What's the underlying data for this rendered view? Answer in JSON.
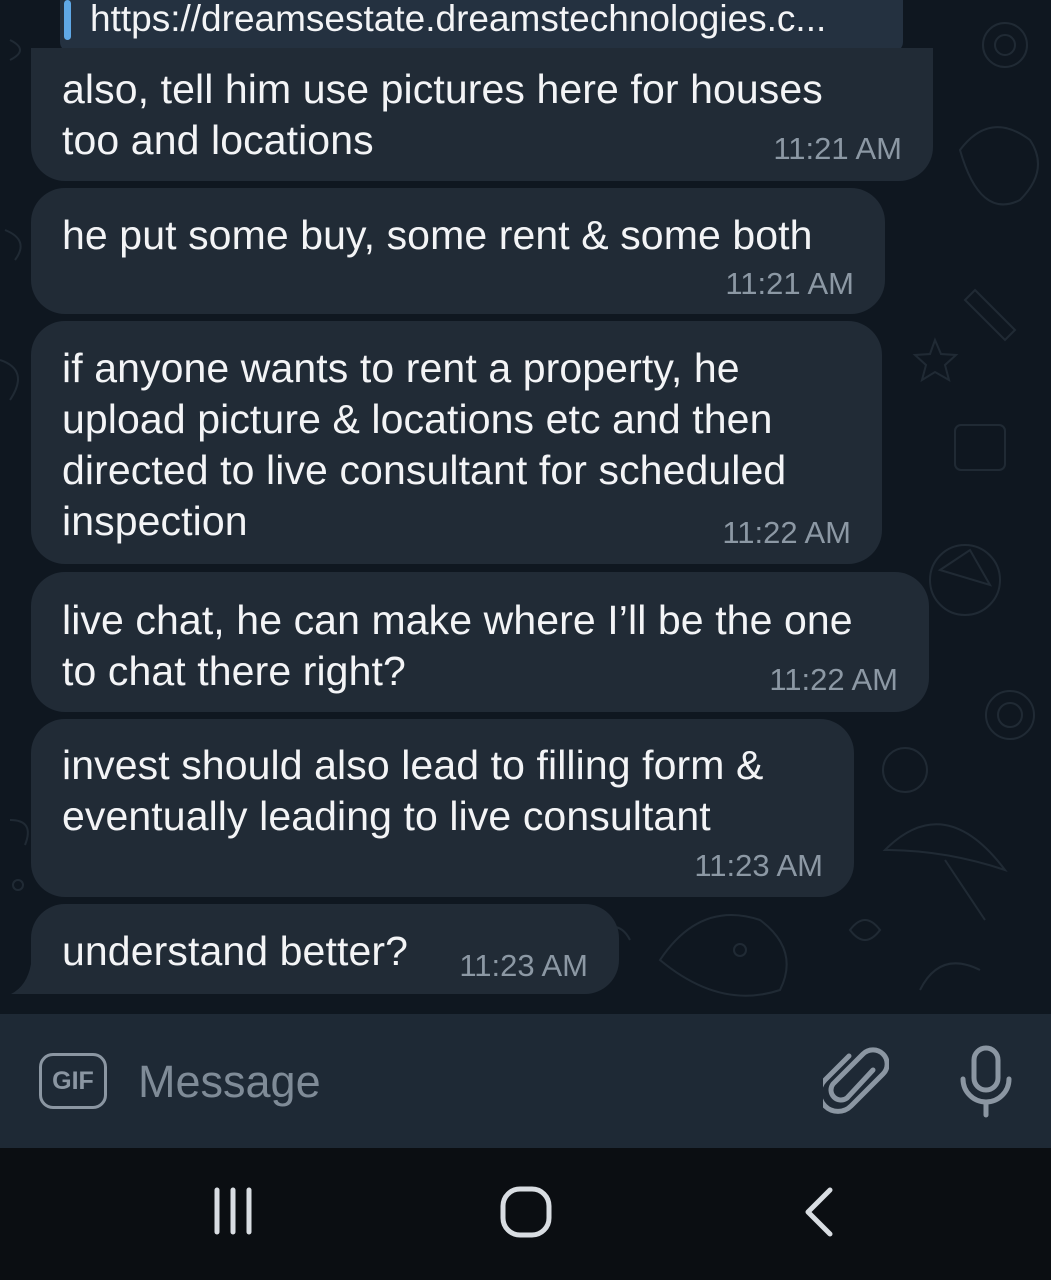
{
  "link_preview": {
    "url": "https://dreamsestate.dreamstechnologies.c..."
  },
  "messages": [
    {
      "text": "also, tell him use pictures here for houses\ntoo and locations",
      "time": "11:21 AM"
    },
    {
      "text": "he put some buy, some rent & some both",
      "time": "11:21 AM"
    },
    {
      "text": "if anyone wants to rent a property, he\nupload picture & locations etc and then\ndirected to live consultant for scheduled\ninspection",
      "time": "11:22 AM"
    },
    {
      "text": "live chat, he can make where I’ll be the one\nto chat there right?",
      "time": "11:22 AM"
    },
    {
      "text": "invest should also lead to filling form &\neventually leading to live consultant",
      "time": "11:23 AM"
    },
    {
      "text": "understand better?",
      "time": "11:23 AM"
    }
  ],
  "composer": {
    "gif_label": "GIF",
    "placeholder": "Message",
    "attach_icon": "paperclip-icon",
    "mic_icon": "microphone-icon"
  },
  "nav": {
    "recents_icon": "recents-icon",
    "home_icon": "home-icon",
    "back_icon": "back-icon"
  },
  "colors": {
    "background": "#0e1621",
    "bubble": "#212b36",
    "text": "#f3f4f6",
    "time": "#8c98a4",
    "link_accent": "#5fa8e6",
    "input_bar": "#1e2935",
    "nav_bar": "#0b0e12"
  }
}
